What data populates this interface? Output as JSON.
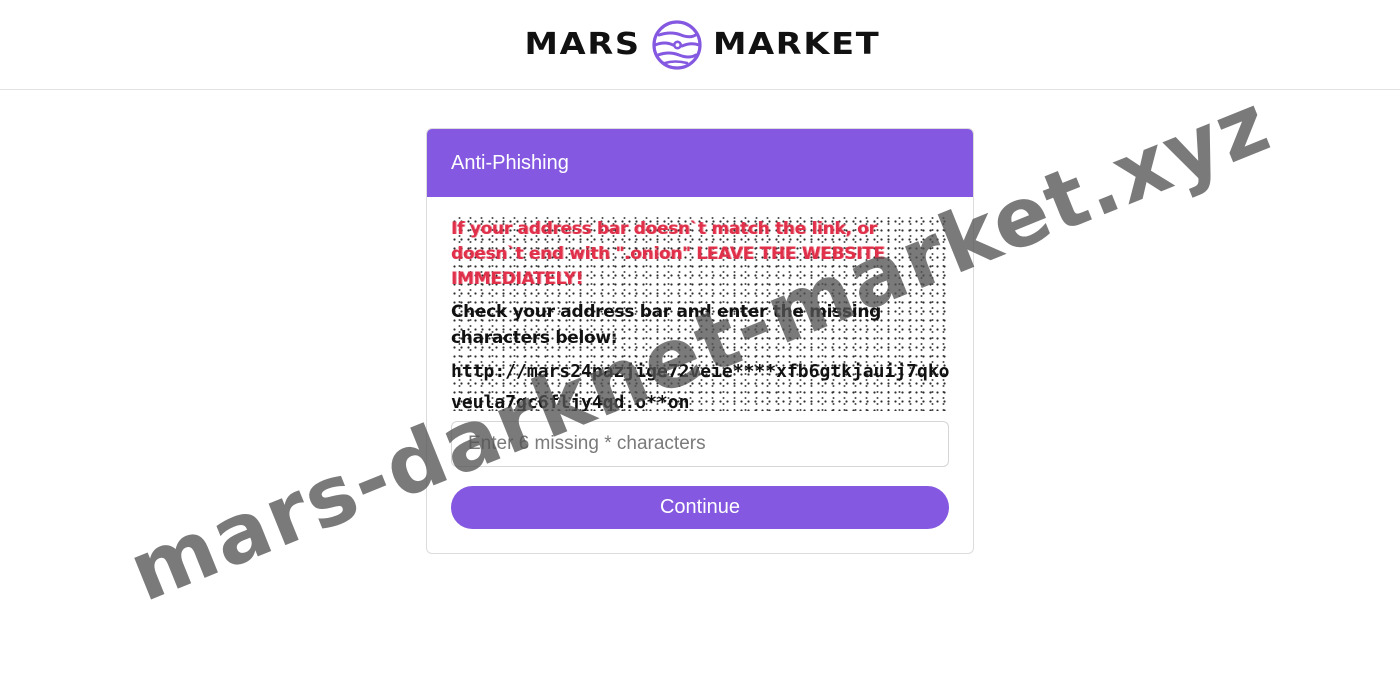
{
  "header": {
    "brand_left": "MARS",
    "brand_right": "MARKET",
    "brand_color": "#8458e0"
  },
  "card": {
    "title": "Anti-Phishing",
    "captcha": {
      "warning": "If your address bar doesn`t match the link, or doesn`t end with \".onion\" LEAVE THE WEBSITE IMMEDIATELY!",
      "instruction": "Check your address bar and enter the missing characters below:",
      "url": "http://mars24pazjige72veie****xfb6gtkjauij7qkofveula7gc6fljy4qd.o**on"
    },
    "input": {
      "placeholder": "Enter 6 missing * characters",
      "value": ""
    },
    "continue_label": "Continue"
  },
  "watermark": "mars-darknet-market.xyz",
  "colors": {
    "accent": "#8458e0",
    "warning": "#e0304a",
    "header_text": "#ffffff"
  }
}
